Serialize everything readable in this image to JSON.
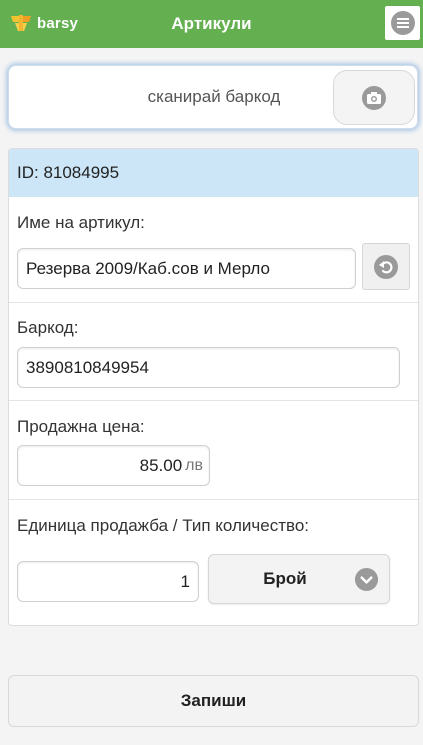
{
  "header": {
    "logo_text": "barsy",
    "title": "Артикули",
    "menu_icon": "menu-icon"
  },
  "scan": {
    "label": "сканирай баркод",
    "camera_icon": "camera-icon"
  },
  "item": {
    "id_text": "ID: 81084995",
    "name_label": "Име на артикул:",
    "name_value": "Резерва 2009/Каб.сов и Мерло",
    "revert_icon": "undo-icon",
    "barcode_label": "Баркод:",
    "barcode_value": "3890810849954",
    "price_label": "Продажна цена:",
    "price_value": "85.00",
    "price_currency": "лв",
    "unit_label": "Единица продажба / Тип количество:",
    "quantity_value": "1",
    "unit_value": "Брой",
    "unit_icon": "chevron-down-icon"
  },
  "actions": {
    "save_label": "Запиши"
  },
  "colors": {
    "header_bg": "#64b050",
    "id_bar_bg": "#cce6f8",
    "icon_gray": "#9a9a9a"
  }
}
